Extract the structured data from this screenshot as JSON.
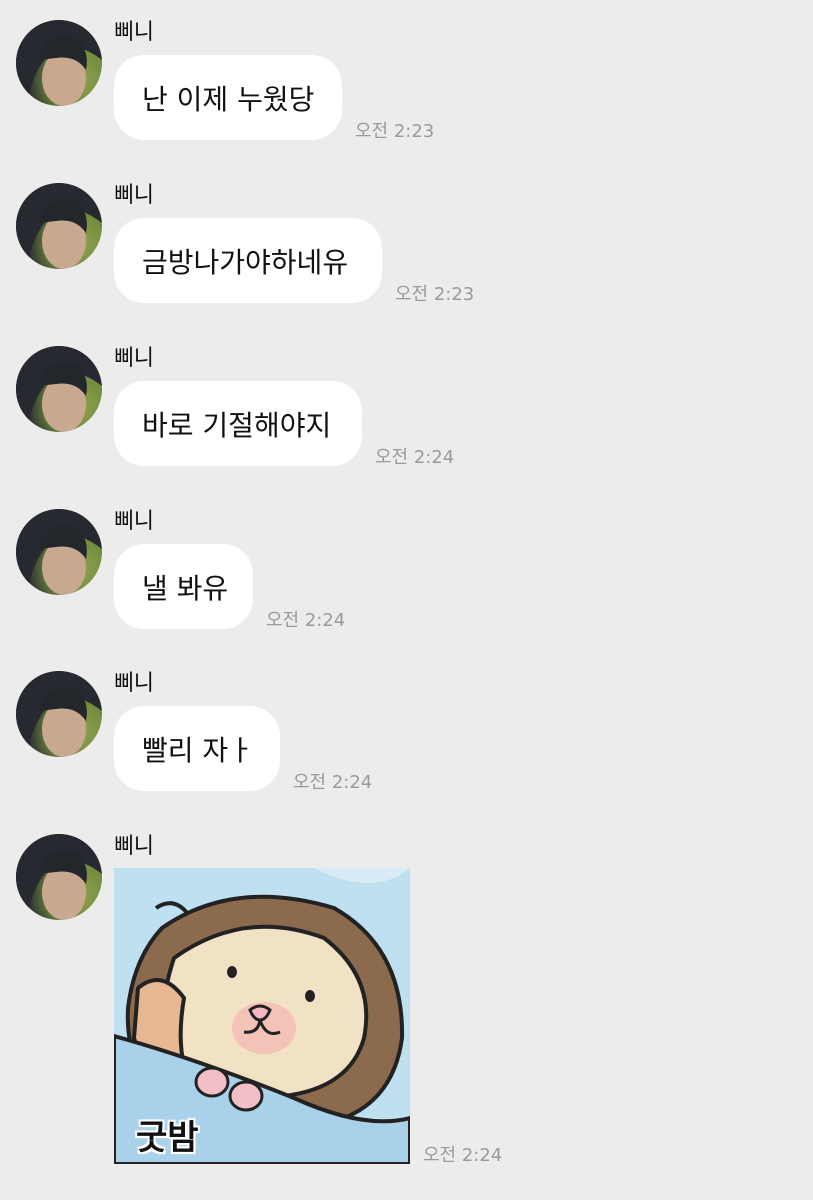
{
  "messages": [
    {
      "sender": "삐니",
      "text": "난 이제 누웠당",
      "time": "오전 2:23"
    },
    {
      "sender": "삐니",
      "text": "금방나가야하네유",
      "time": "오전 2:23"
    },
    {
      "sender": "삐니",
      "text": "바로 기절해야지",
      "time": "오전 2:24"
    },
    {
      "sender": "삐니",
      "text": "낼 봐유",
      "time": "오전 2:24"
    },
    {
      "sender": "삐니",
      "text": "빨리 자ㅏ",
      "time": "오전 2:24"
    }
  ],
  "sticker_message": {
    "sender": "삐니",
    "sticker_text": "굿밤",
    "sticker_name": "hamster-goodnight-sticker",
    "time": "오전 2:24"
  },
  "colors": {
    "background": "#ececec",
    "bubble": "#ffffff",
    "timestamp": "#9a9a9a",
    "sticker_bg": "#bfe0f0"
  }
}
